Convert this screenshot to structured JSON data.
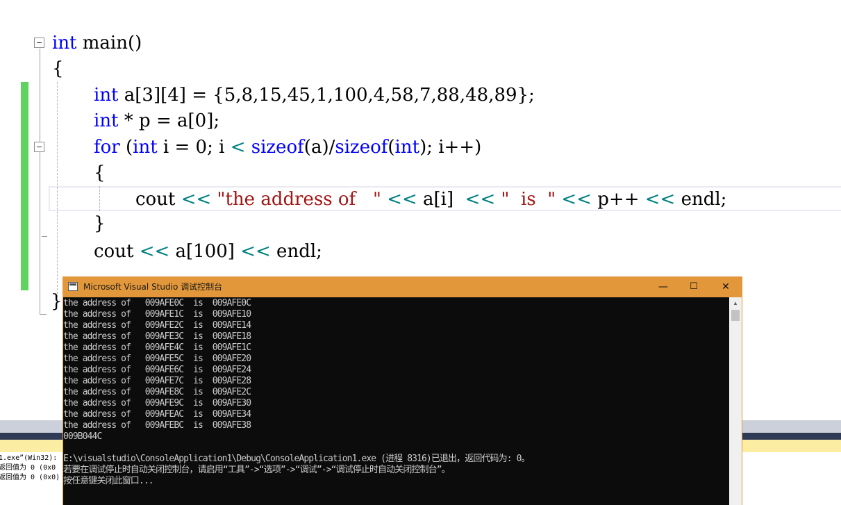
{
  "editor": {
    "lines": [
      [
        {
          "t": "int",
          "c": "kw"
        },
        {
          "t": " main()"
        }
      ],
      [
        {
          "t": "{"
        }
      ],
      [
        {
          "t": "int",
          "c": "kw"
        },
        {
          "t": " a[3][4] = {5,8,15,45,1,100,4,58,7,88,48,89};"
        }
      ],
      [
        {
          "t": "int",
          "c": "kw"
        },
        {
          "t": " * p = a[0];"
        }
      ],
      [
        {
          "t": "for",
          "c": "kw"
        },
        {
          "t": " ("
        },
        {
          "t": "int",
          "c": "kw"
        },
        {
          "t": " i = 0; i "
        },
        {
          "t": "<",
          "c": "op"
        },
        {
          "t": " "
        },
        {
          "t": "sizeof",
          "c": "kw"
        },
        {
          "t": "(a)/"
        },
        {
          "t": "sizeof",
          "c": "kw"
        },
        {
          "t": "("
        },
        {
          "t": "int",
          "c": "kw"
        },
        {
          "t": "); i++)"
        }
      ],
      [
        {
          "t": "{"
        }
      ],
      [
        {
          "t": "cout "
        },
        {
          "t": "<<",
          "c": "op"
        },
        {
          "t": " "
        },
        {
          "t": "\"the address of   \"",
          "c": "str"
        },
        {
          "t": " "
        },
        {
          "t": "<<",
          "c": "op"
        },
        {
          "t": " a[i]  "
        },
        {
          "t": "<<",
          "c": "op"
        },
        {
          "t": " "
        },
        {
          "t": "\"  is  \"",
          "c": "str"
        },
        {
          "t": " "
        },
        {
          "t": "<<",
          "c": "op"
        },
        {
          "t": " p++ "
        },
        {
          "t": "<<",
          "c": "op"
        },
        {
          "t": " endl;"
        }
      ],
      [
        {
          "t": "}"
        }
      ],
      [
        {
          "t": "cout "
        },
        {
          "t": "<<",
          "c": "op"
        },
        {
          "t": " a[100] "
        },
        {
          "t": "<<",
          "c": "op"
        },
        {
          "t": " endl;"
        }
      ],
      [],
      [
        {
          "t": "}"
        }
      ]
    ]
  },
  "console": {
    "title": "Microsoft Visual Studio 调试控制台",
    "buttons": {
      "minimize": "—",
      "maximize": "☐",
      "close": "✕"
    },
    "lines": [
      "the address of   009AFE0C  is  009AFE0C",
      "the address of   009AFE1C  is  009AFE10",
      "the address of   009AFE2C  is  009AFE14",
      "the address of   009AFE3C  is  009AFE18",
      "the address of   009AFE4C  is  009AFE1C",
      "the address of   009AFE5C  is  009AFE20",
      "the address of   009AFE6C  is  009AFE24",
      "the address of   009AFE7C  is  009AFE28",
      "the address of   009AFE8C  is  009AFE2C",
      "the address of   009AFE9C  is  009AFE30",
      "the address of   009AFEAC  is  009AFE34",
      "the address of   009AFEBC  is  009AFE38",
      "009B044C",
      "",
      "E:\\visualstudio\\ConsoleApplication1\\Debug\\ConsoleApplication1.exe (进程 8316)已退出，返回代码为: 0。",
      "若要在调试停止时自动关闭控制台，请启用“工具”->“选项”->“调试”->“调试停止时自动关闭控制台”。",
      "按任意键关闭此窗口..."
    ]
  },
  "output_panel": {
    "lines": [
      "1.exe”(Win32):",
      "返回值为 0 (0x0",
      "返回值为 0 (0x0)"
    ]
  }
}
